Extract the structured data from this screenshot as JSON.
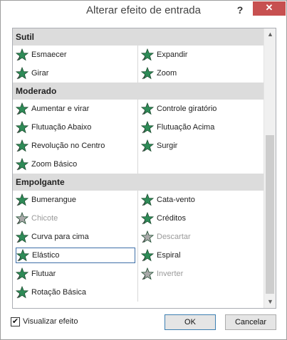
{
  "window": {
    "title": "Alterar efeito de entrada",
    "help_label": "?",
    "close_label": "✕"
  },
  "sections": [
    {
      "header": "Sutil",
      "items": [
        {
          "label": "Esmaecer",
          "icon": "star-effect-icon",
          "enabled": true
        },
        {
          "label": "Expandir",
          "icon": "star-effect-icon",
          "enabled": true
        },
        {
          "label": "Girar",
          "icon": "star-effect-icon",
          "enabled": true
        },
        {
          "label": "Zoom",
          "icon": "star-effect-icon",
          "enabled": true
        }
      ]
    },
    {
      "header": "Moderado",
      "items": [
        {
          "label": "Aumentar e virar",
          "icon": "star-effect-icon",
          "enabled": true
        },
        {
          "label": "Controle giratório",
          "icon": "star-effect-icon",
          "enabled": true
        },
        {
          "label": "Flutuação Abaixo",
          "icon": "star-effect-icon",
          "enabled": true
        },
        {
          "label": "Flutuação Acima",
          "icon": "star-effect-icon",
          "enabled": true
        },
        {
          "label": "Revolução no Centro",
          "icon": "star-effect-icon",
          "enabled": true
        },
        {
          "label": "Surgir",
          "icon": "star-effect-icon",
          "enabled": true
        },
        {
          "label": "Zoom Básico",
          "icon": "star-effect-icon",
          "enabled": true
        }
      ]
    },
    {
      "header": "Empolgante",
      "items": [
        {
          "label": "Bumerangue",
          "icon": "star-effect-icon",
          "enabled": true
        },
        {
          "label": "Cata-vento",
          "icon": "star-effect-icon",
          "enabled": true
        },
        {
          "label": "Chicote",
          "icon": "star-effect-icon",
          "enabled": false
        },
        {
          "label": "Créditos",
          "icon": "star-effect-icon",
          "enabled": true
        },
        {
          "label": "Curva para cima",
          "icon": "star-effect-icon",
          "enabled": true
        },
        {
          "label": "Descartar",
          "icon": "star-effect-icon",
          "enabled": false
        },
        {
          "label": "Elástico",
          "icon": "star-effect-icon",
          "enabled": true,
          "selected": true
        },
        {
          "label": "Espiral",
          "icon": "star-effect-icon",
          "enabled": true
        },
        {
          "label": "Flutuar",
          "icon": "star-effect-icon",
          "enabled": true
        },
        {
          "label": "Inverter",
          "icon": "star-effect-icon",
          "enabled": false
        },
        {
          "label": "Rotação Básica",
          "icon": "star-effect-icon",
          "enabled": true
        }
      ]
    }
  ],
  "footer": {
    "preview_label": "Visualizar efeito",
    "preview_checked": true,
    "ok_label": "OK",
    "cancel_label": "Cancelar"
  },
  "colors": {
    "star_green": "#2e8b57",
    "star_disabled": "#a9a9a9",
    "close_red": "#c75050",
    "section_bg": "#dcdcdc",
    "selection_border": "#3e6fa8"
  }
}
